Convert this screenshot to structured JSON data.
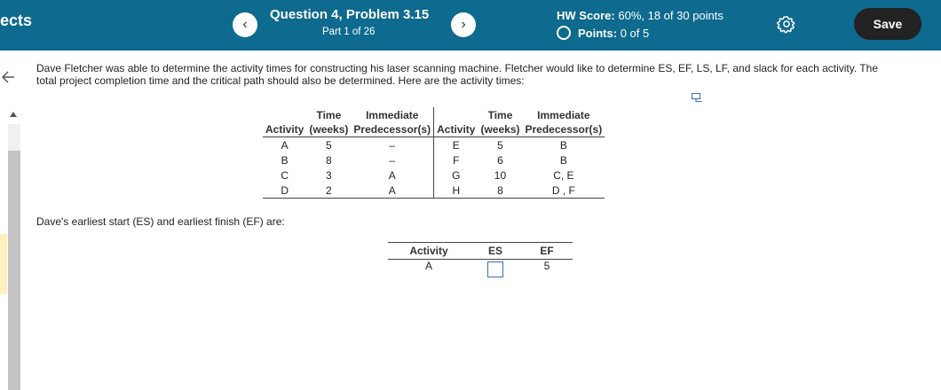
{
  "header": {
    "left_fragment": "ects",
    "prev_label": "‹",
    "next_label": "›",
    "question_title": "Question 4, Problem 3.15",
    "part": "Part 1 of 26",
    "hw_score_label": "HW Score:",
    "hw_score_value": "60%, 18 of 30 points",
    "points_label": "Points:",
    "points_value": "0 of 5",
    "save_label": "Save"
  },
  "problem": {
    "text": "Dave Fletcher was able to determine the activity times for constructing his laser scanning machine. Fletcher would like to determine ES, EF, LS, LF, and slack for each activity. The total project completion time and the critical path should also be determined. Here are the activity times:"
  },
  "activity_table": {
    "headers": {
      "activity": "Activity",
      "time_line1": "Time",
      "time_line2": "(weeks)",
      "pred_line1": "Immediate",
      "pred_line2": "Predecessor(s)"
    },
    "rows": [
      {
        "a1": "A",
        "t1": "5",
        "p1": "–",
        "a2": "E",
        "t2": "5",
        "p2": "B"
      },
      {
        "a1": "B",
        "t1": "8",
        "p1": "–",
        "a2": "F",
        "t2": "6",
        "p2": "B"
      },
      {
        "a1": "C",
        "t1": "3",
        "p1": "A",
        "a2": "G",
        "t2": "10",
        "p2": "C, E"
      },
      {
        "a1": "D",
        "t1": "2",
        "p1": "A",
        "a2": "H",
        "t2": "8",
        "p2": "D , F"
      }
    ]
  },
  "es_question": "Dave's earliest start (ES) and earliest finish (EF) are:",
  "answer_table": {
    "headers": {
      "activity": "Activity",
      "es": "ES",
      "ef": "EF"
    },
    "rows": [
      {
        "activity": "A",
        "es": "",
        "ef": "5"
      }
    ]
  }
}
